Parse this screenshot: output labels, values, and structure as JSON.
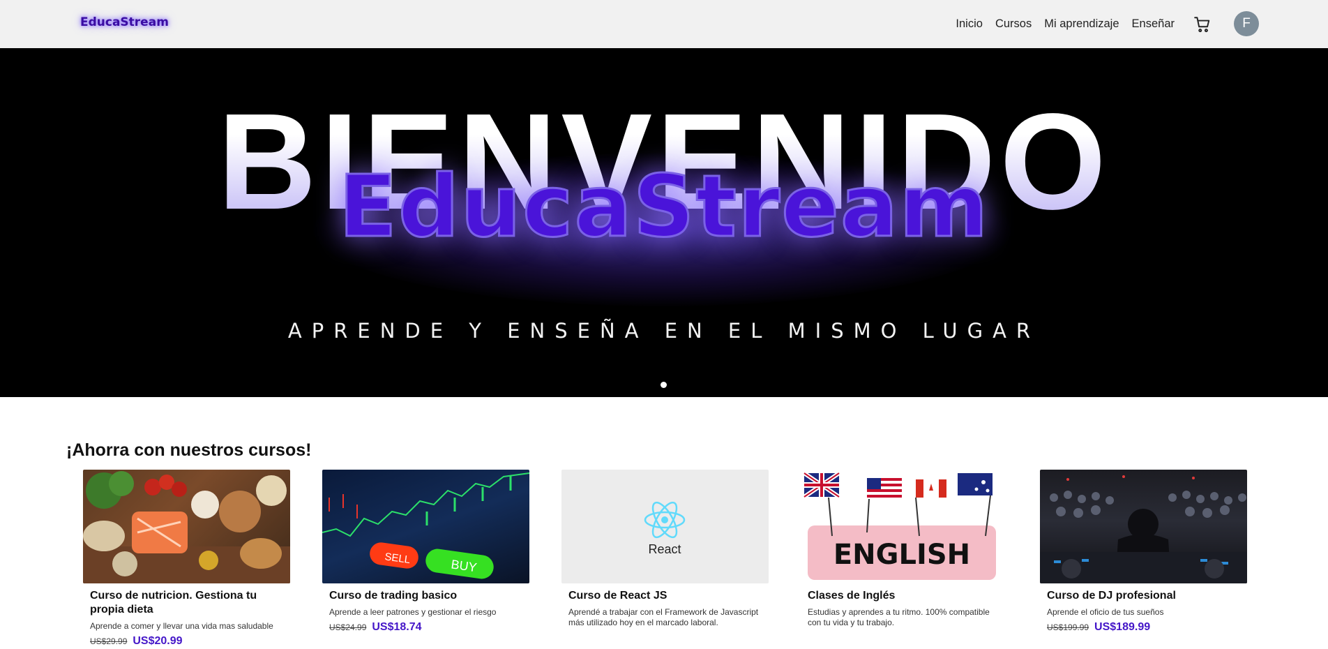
{
  "navbar": {
    "brand": "EducaStream",
    "links": [
      "Inicio",
      "Cursos",
      "Mi aprendizaje",
      "Enseñar"
    ],
    "cart_icon": "cart-icon",
    "avatar_initial": "F"
  },
  "hero": {
    "title": "BIENVENIDO",
    "brand": "EducaStream",
    "subtitle": "APRENDE Y ENSEÑA EN EL MISMO LUGAR"
  },
  "section": {
    "title": "¡Ahorra con nuestros cursos!"
  },
  "colors": {
    "accent": "#4416c8",
    "navbar_bg": "#f1f1f1",
    "hero_bg": "#000000"
  },
  "courses": [
    {
      "title": "Curso de nutricion. Gestiona tu propia dieta",
      "description": "Aprende a comer y llevar una vida mas saludable",
      "old_price": "US$29.99",
      "new_price": "US$20.99"
    },
    {
      "title": "Curso de trading basico",
      "description": "Aprende a leer patrones y gestionar el riesgo",
      "old_price": "US$24.99",
      "new_price": "US$18.74",
      "img_labels": [
        "SELL",
        "BUY"
      ]
    },
    {
      "title": "Curso de React JS",
      "description": "Aprendé a trabajar con el Framework de Javascript más utilizado hoy en el marcado laboral.",
      "old_price": "",
      "new_price": "",
      "img_label": "React"
    },
    {
      "title": "Clases de Inglés",
      "description": "Estudias y aprendes a tu ritmo. 100% compatible con tu vida y tu trabajo.",
      "old_price": "",
      "new_price": "",
      "img_label": "ENGLISH"
    },
    {
      "title": "Curso de DJ profesional",
      "description": "Aprende el oficio de tus sueños",
      "old_price": "US$199.99",
      "new_price": "US$189.99"
    }
  ]
}
